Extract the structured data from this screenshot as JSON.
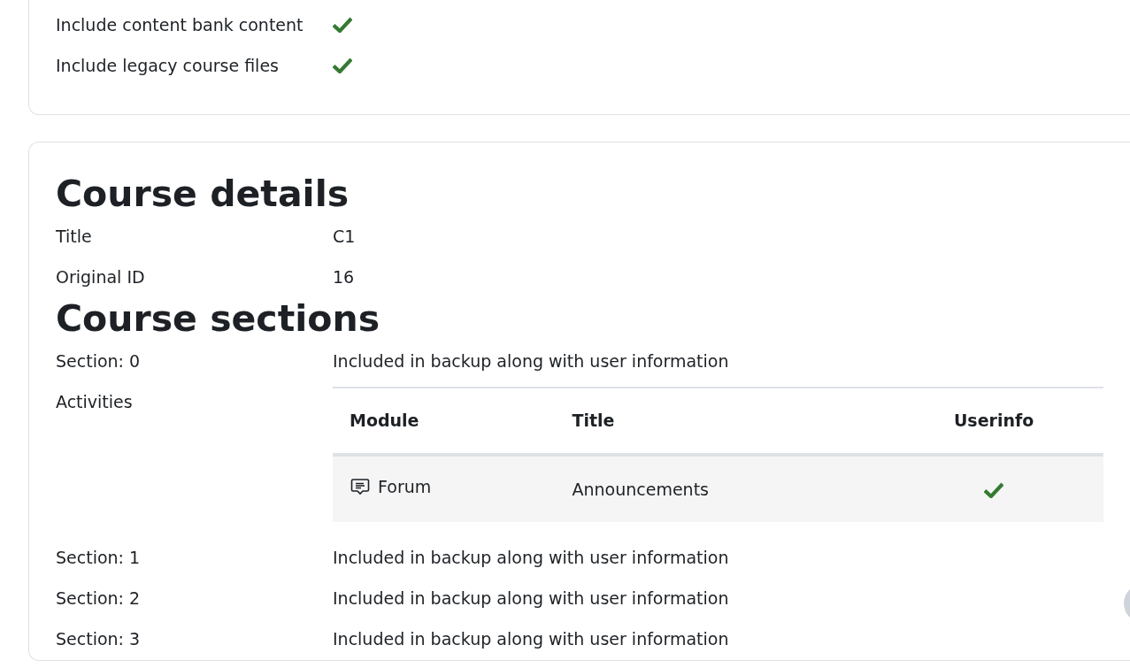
{
  "settings": [
    {
      "label": "Include content bank content",
      "checked": true
    },
    {
      "label": "Include legacy course files",
      "checked": true
    }
  ],
  "course_details": {
    "heading": "Course details",
    "fields": [
      {
        "label": "Title",
        "value": "C1"
      },
      {
        "label": "Original ID",
        "value": "16"
      }
    ]
  },
  "course_sections": {
    "heading": "Course sections",
    "sections": [
      {
        "label": "Section: 0",
        "value": "Included in backup along with user information",
        "activities": {
          "label": "Activities",
          "columns": [
            "Module",
            "Title",
            "Userinfo"
          ],
          "rows": [
            {
              "module": "Forum",
              "title": "Announcements",
              "userinfo": true
            }
          ]
        }
      },
      {
        "label": "Section: 1",
        "value": "Included in backup along with user information"
      },
      {
        "label": "Section: 2",
        "value": "Included in backup along with user information"
      },
      {
        "label": "Section: 3",
        "value": "Included in backup along with user information"
      }
    ]
  }
}
